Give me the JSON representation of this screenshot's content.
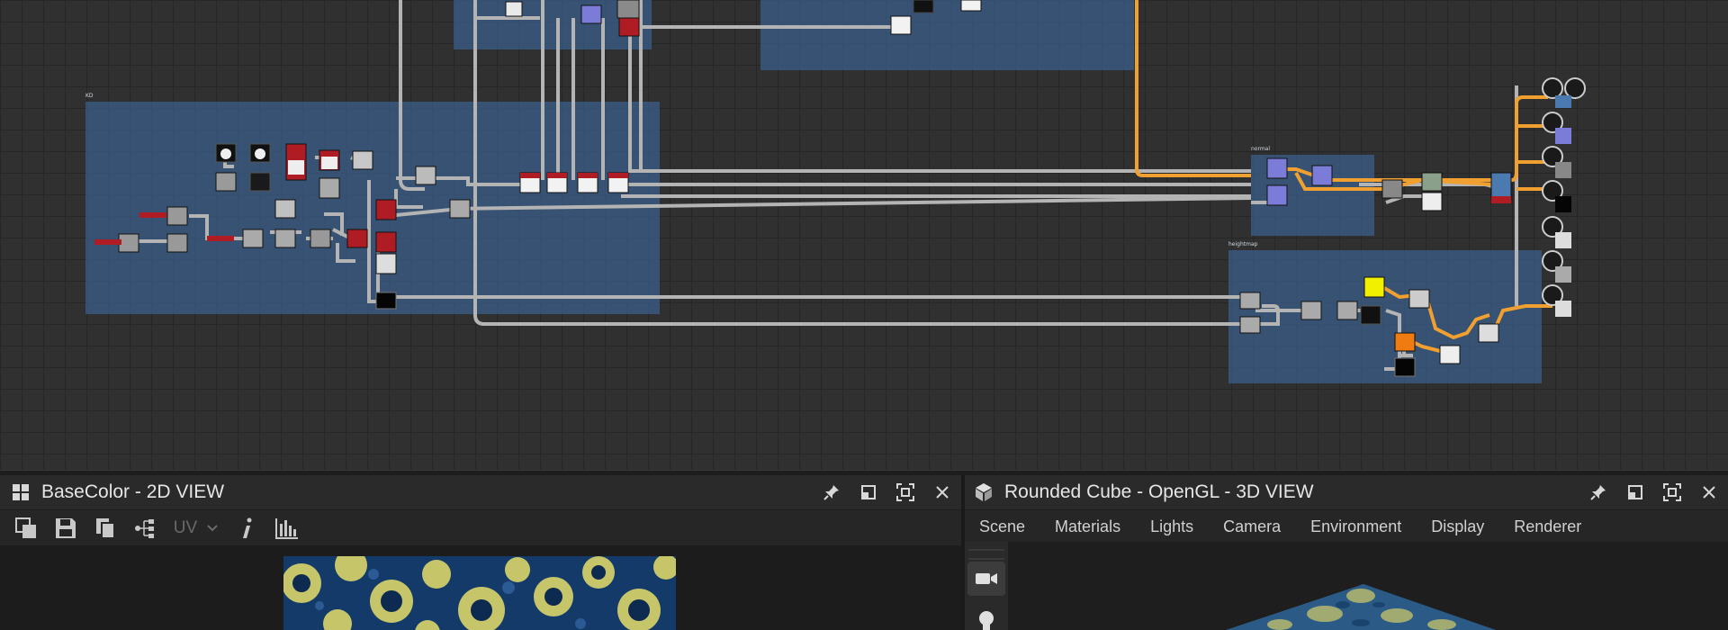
{
  "graph": {
    "frames": [
      {
        "label": "KD"
      },
      {
        "label": "normal"
      },
      {
        "label": "heightmap"
      }
    ]
  },
  "panel2d": {
    "title": "BaseColor - 2D VIEW",
    "toolbar": {
      "uv_label": "UV"
    },
    "icons": [
      "copy-to-clipboard-icon",
      "save-icon",
      "copy-icon",
      "share-icon",
      "uv-dropdown-icon",
      "info-icon",
      "histogram-icon"
    ]
  },
  "panel3d": {
    "title": "Rounded Cube - OpenGL - 3D VIEW",
    "menu": [
      "Scene",
      "Materials",
      "Lights",
      "Camera",
      "Environment",
      "Display",
      "Renderer"
    ]
  },
  "colors": {
    "graph_bg": "#303030",
    "frame": "#3a5f8c",
    "wire": "#b4b4b4",
    "wire_active": "#f0a030",
    "node_red": "#b01c24"
  }
}
